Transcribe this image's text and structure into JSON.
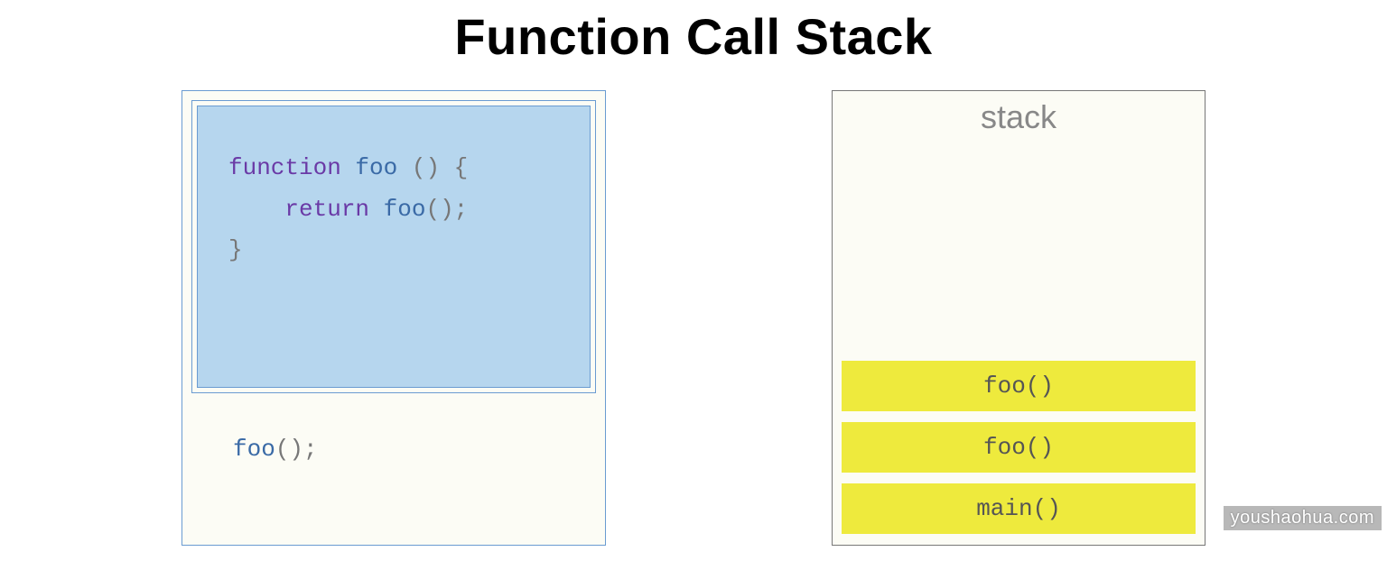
{
  "title": "Function Call Stack",
  "code": {
    "line1_kw": "function",
    "line1_fn": " foo ",
    "line1_rest": "() {",
    "line2_indent": "    ",
    "line2_kw": "return",
    "line2_fn": " foo",
    "line2_rest": "();",
    "line3": "}",
    "call_fn": "foo",
    "call_rest": "();"
  },
  "stack": {
    "label": "stack",
    "frames": [
      "foo()",
      "foo()",
      "main()"
    ]
  },
  "watermark": "youshaohua.com"
}
